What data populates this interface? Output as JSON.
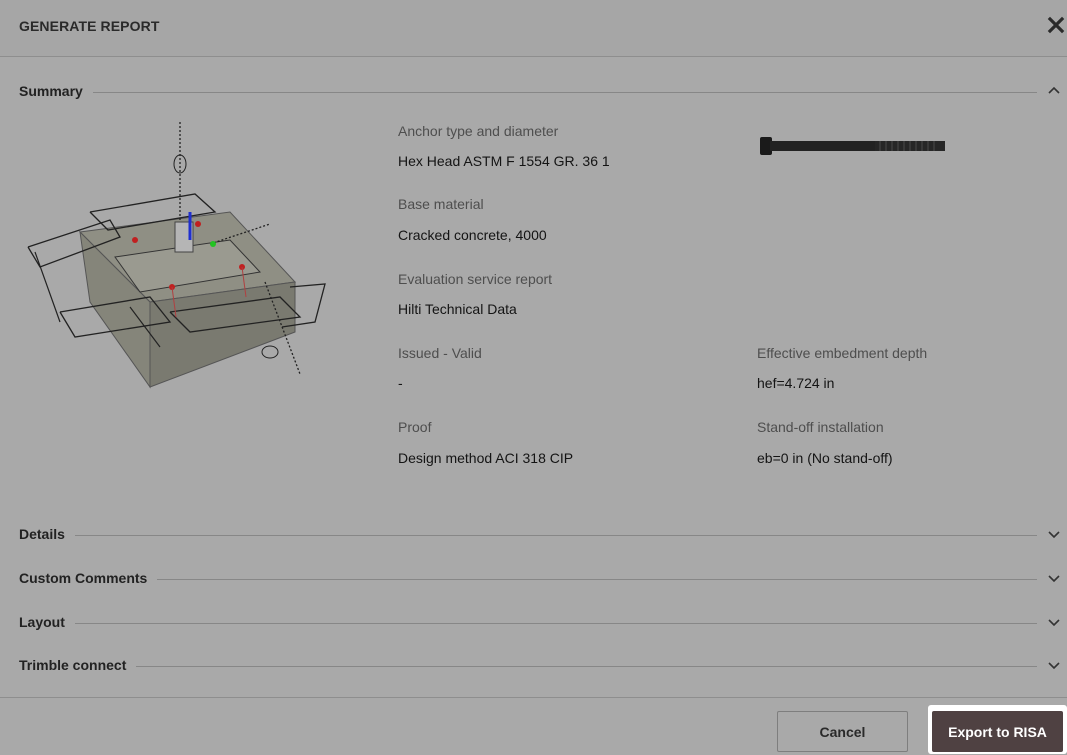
{
  "dialog": {
    "title": "GENERATE REPORT",
    "close_icon": "close-icon"
  },
  "sections": {
    "summary": {
      "label": "Summary",
      "expanded": true
    },
    "details": {
      "label": "Details",
      "expanded": false
    },
    "custom_comments": {
      "label": "Custom Comments",
      "expanded": false
    },
    "layout": {
      "label": "Layout",
      "expanded": false
    },
    "trimble_connect": {
      "label": "Trimble connect",
      "expanded": false
    }
  },
  "summary": {
    "anchor_type": {
      "label": "Anchor type and diameter",
      "value": "Hex Head ASTM F 1554 GR. 36 1"
    },
    "base_material": {
      "label": "Base material",
      "value": "Cracked concrete, 4000"
    },
    "evaluation_report": {
      "label": "Evaluation service report",
      "value": "Hilti Technical Data"
    },
    "issued_valid": {
      "label": "Issued - Valid",
      "value": "-"
    },
    "proof": {
      "label": "Proof",
      "value": "Design method ACI 318 CIP"
    },
    "embedment_depth": {
      "label": "Effective embedment depth",
      "value": "hef=4.724 in"
    },
    "standoff": {
      "label": "Stand-off installation",
      "value": "eb=0 in (No stand-off)"
    }
  },
  "footer": {
    "cancel_label": "Cancel",
    "export_label": "Export to RISA"
  },
  "colors": {
    "background": "#a9a9a9",
    "export_button": "#4f4142",
    "label_text": "#4e4e4e"
  }
}
